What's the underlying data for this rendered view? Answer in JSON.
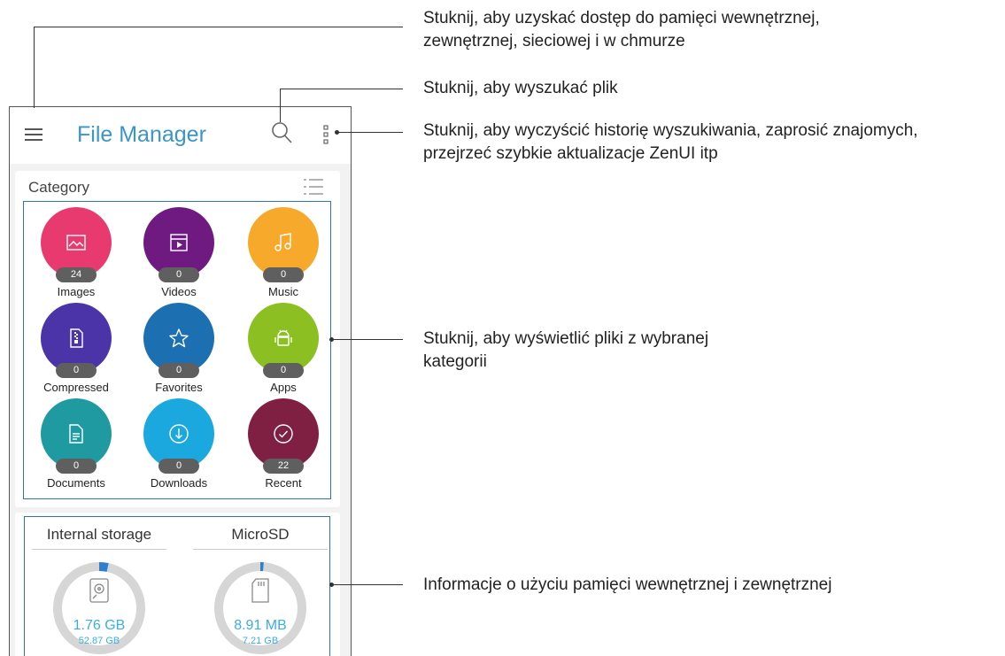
{
  "app": {
    "title": "File Manager"
  },
  "icons": {
    "menu": "hamburger-menu-icon",
    "search": "search-icon",
    "more": "more-vert-icon",
    "list_view": "list-view-icon"
  },
  "category": {
    "title": "Category",
    "items": [
      {
        "label": "Images",
        "count": "24",
        "color": "#e83a6e",
        "icon": "image-icon"
      },
      {
        "label": "Videos",
        "count": "0",
        "color": "#6e1a80",
        "icon": "video-icon"
      },
      {
        "label": "Music",
        "count": "0",
        "color": "#f6a92a",
        "icon": "music-icon"
      },
      {
        "label": "Compressed",
        "count": "0",
        "color": "#4b34a8",
        "icon": "zip-icon"
      },
      {
        "label": "Favorites",
        "count": "0",
        "color": "#1c6fb0",
        "icon": "star-icon"
      },
      {
        "label": "Apps",
        "count": "0",
        "color": "#8bbf22",
        "icon": "android-icon"
      },
      {
        "label": "Documents",
        "count": "0",
        "color": "#1f9aa0",
        "icon": "document-icon"
      },
      {
        "label": "Downloads",
        "count": "0",
        "color": "#1aa8df",
        "icon": "download-icon"
      },
      {
        "label": "Recent",
        "count": "22",
        "color": "#7f2043",
        "icon": "check-icon"
      }
    ]
  },
  "storage": [
    {
      "name": "Internal storage",
      "used": "1.76 GB",
      "total": "52.87 GB",
      "used_fraction": 0.033,
      "icon": "hard-drive-icon"
    },
    {
      "name": "MicroSD",
      "used": "8.91 MB",
      "total": "7.21 GB",
      "used_fraction": 0.012,
      "icon": "sd-card-icon"
    }
  ],
  "colors": {
    "accent": "#3a95c8",
    "gauge_track": "#d6d6d6",
    "gauge_used": "#2f7fd0",
    "callout_line": "#2b74b5"
  },
  "callouts": {
    "menu_line1": "Stuknij, aby uzyskać dostęp do pamięci wewnętrznej,",
    "menu_line2": "zewnętrznej, sieciowej i w chmurze",
    "search": "Stuknij, aby wyszukać plik",
    "more_line1": "Stuknij, aby wyczyścić historię wyszukiwania, zaprosić znajomych,",
    "more_line2": "przejrzeć szybkie aktualizacje ZenUI itp",
    "category_line1": "Stuknij, aby wyświetlić pliki z wybranej",
    "category_line2": "kategorii",
    "storage": "Informacje o użyciu pamięci wewnętrznej i zewnętrznej"
  }
}
